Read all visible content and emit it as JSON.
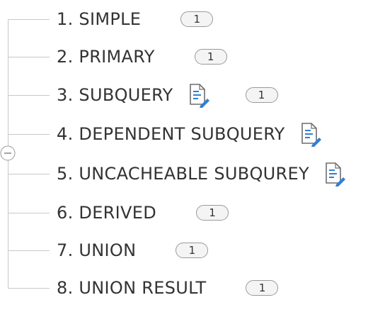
{
  "tree": {
    "nodes": [
      {
        "label": "1. SIMPLE",
        "badge": "1",
        "has_note": false
      },
      {
        "label": "2. PRIMARY",
        "badge": "1",
        "has_note": false
      },
      {
        "label": "3. SUBQUERY",
        "badge": "1",
        "has_note": true
      },
      {
        "label": "4. DEPENDENT SUBQUERY",
        "badge": "",
        "has_note": true
      },
      {
        "label": "5. UNCACHEABLE SUBQUREY",
        "badge": "",
        "has_note": true
      },
      {
        "label": "6. DERIVED",
        "badge": "1",
        "has_note": false
      },
      {
        "label": "7. UNION",
        "badge": "1",
        "has_note": false
      },
      {
        "label": "8. UNION RESULT",
        "badge": "1",
        "has_note": false
      }
    ],
    "collapse_icon": "minus-circle-icon",
    "note_icon": "note-edit-icon"
  },
  "colors": {
    "line": "#c8c8c8",
    "text": "#333333",
    "badge_border": "#9a9a9a",
    "badge_fill": "#f4f4f4",
    "note_outline": "#6d6d6d",
    "note_lines": "#2f7fd6",
    "pencil": "#2f7fd6"
  }
}
